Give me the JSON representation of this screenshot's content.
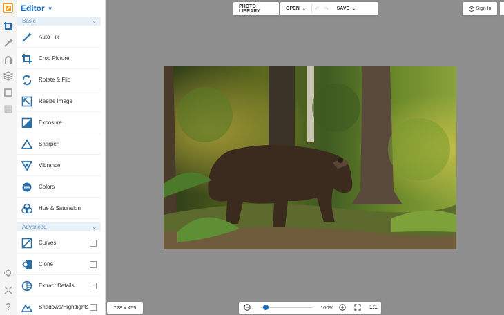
{
  "app": {
    "title": "Editor"
  },
  "sections": {
    "basic": "Basic",
    "advanced": "Advanced"
  },
  "tools": {
    "auto_fix": "Auto Fix",
    "crop": "Crop Picture",
    "rotate": "Rotate & Flip",
    "resize": "Resize Image",
    "exposure": "Exposure",
    "sharpen": "Sharpen",
    "vibrance": "Vibrance",
    "colors": "Colors",
    "hue": "Hue & Saturation",
    "curves": "Curves",
    "clone": "Clone",
    "extract": "Extract Details",
    "shadows": "Shadows/Hightlights"
  },
  "toolbar": {
    "photo_library": "PHOTO LIBRARY",
    "open": "OPEN",
    "save": "SAVE",
    "sign_in": "Sign In"
  },
  "status": {
    "image_size": "728 x 455",
    "zoom": "100%",
    "ratio": "1:1",
    "zoom_level": 0.1
  },
  "colors": {
    "accent": "#1b6ec2",
    "logo": "#f39a1f",
    "canvas": "#8e8e8e"
  },
  "icons": [
    "logo-icon",
    "crop-icon",
    "magic-wand-icon",
    "head-icon",
    "layers-icon",
    "frame-icon",
    "texture-icon",
    "bulb-icon",
    "collapse-icon",
    "help-icon"
  ]
}
